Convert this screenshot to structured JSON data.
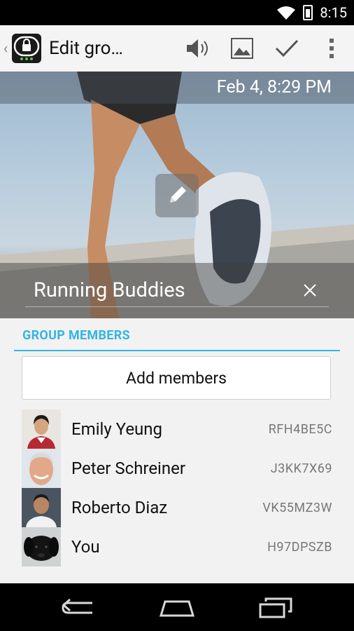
{
  "status": {
    "time": "8:15"
  },
  "actionbar": {
    "title": "Edit gro…",
    "actions": [
      "speaker-icon",
      "image-icon",
      "check-icon",
      "overflow-menu-icon"
    ]
  },
  "hero": {
    "date": "Feb 4, 8:29 PM",
    "group_name": "Running Buddies"
  },
  "members_section": {
    "title": "GROUP MEMBERS",
    "add_label": "Add members",
    "members": [
      {
        "name": "Emily Yeung",
        "code": "RFH4BE5C"
      },
      {
        "name": "Peter Schreiner",
        "code": "J3KK7X69"
      },
      {
        "name": "Roberto Diaz",
        "code": "VK55MZ3W"
      },
      {
        "name": "You",
        "code": "H97DPSZB"
      }
    ]
  },
  "colors": {
    "accent": "#33b5e5",
    "statusbar": "#000000",
    "actionbar": "#f4f4f4"
  }
}
